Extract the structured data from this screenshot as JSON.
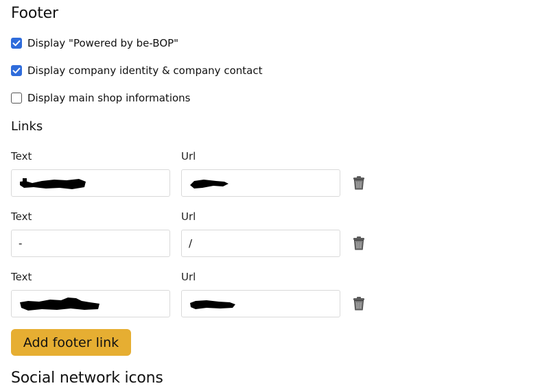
{
  "footer": {
    "title": "Footer",
    "checkboxes": [
      {
        "label": "Display \"Powered by be-BOP\"",
        "checked": true
      },
      {
        "label": "Display company identity & company contact",
        "checked": true
      },
      {
        "label": "Display main shop informations",
        "checked": false
      }
    ]
  },
  "links": {
    "title": "Links",
    "text_label": "Text",
    "url_label": "Url",
    "rows": [
      {
        "text": "",
        "url": "",
        "text_redacted": true,
        "url_redacted": true
      },
      {
        "text": "-",
        "url": "/",
        "text_redacted": false,
        "url_redacted": false
      },
      {
        "text": "",
        "url": "",
        "text_redacted": true,
        "url_redacted": true
      }
    ],
    "delete_icon": "trash-icon",
    "add_button_label": "Add footer link"
  },
  "social": {
    "title": "Social network icons"
  },
  "colors": {
    "checkbox_checked": "#2f6cdb",
    "button_accent": "#e6ae32"
  }
}
